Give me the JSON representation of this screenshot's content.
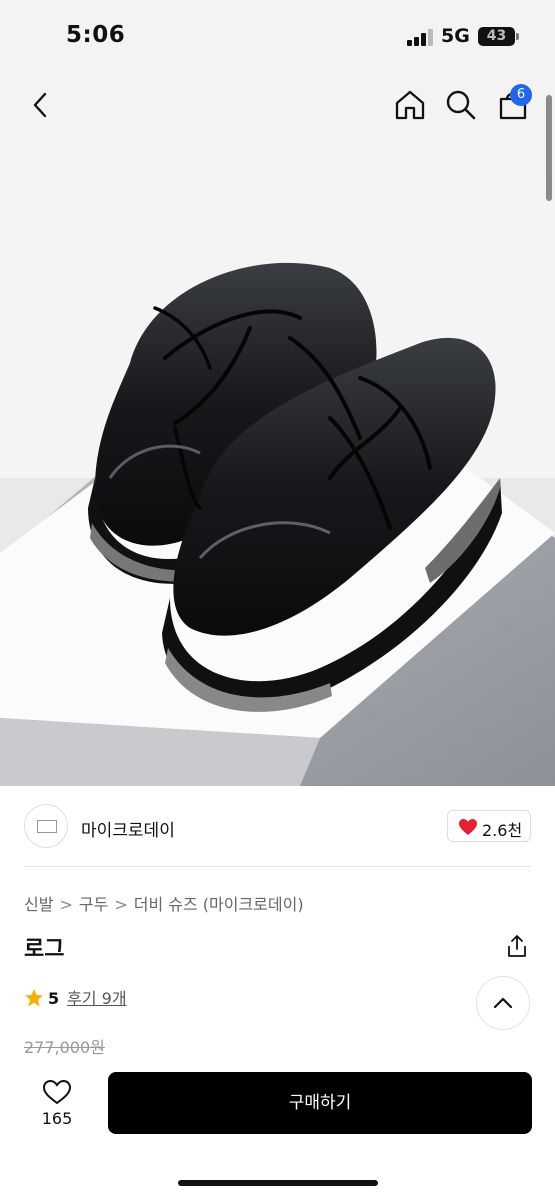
{
  "status_bar": {
    "time": "5:06",
    "network": "5G",
    "battery": "43"
  },
  "nav": {
    "cart_count": "6"
  },
  "shop": {
    "name": "마이크로데이",
    "likes": "2.6천"
  },
  "breadcrumb": {
    "level1": "신발",
    "level2": "구두",
    "level3": "더비 슈즈 (마이크로데이)"
  },
  "product": {
    "title": "로그",
    "rating": "5",
    "reviews_label": "후기 9개",
    "original_price": "277,000원"
  },
  "bottom_bar": {
    "wish_count": "165",
    "buy_label": "구매하기"
  },
  "colors": {
    "accent_blue": "#2266ee",
    "heart_red": "#e8202e",
    "star_yellow": "#f5b301",
    "buy_button": "#000000"
  },
  "icons": [
    "back-icon",
    "home-icon",
    "search-icon",
    "shopping-bag-icon",
    "heart-icon",
    "share-icon",
    "star-icon",
    "chevron-up-icon"
  ]
}
